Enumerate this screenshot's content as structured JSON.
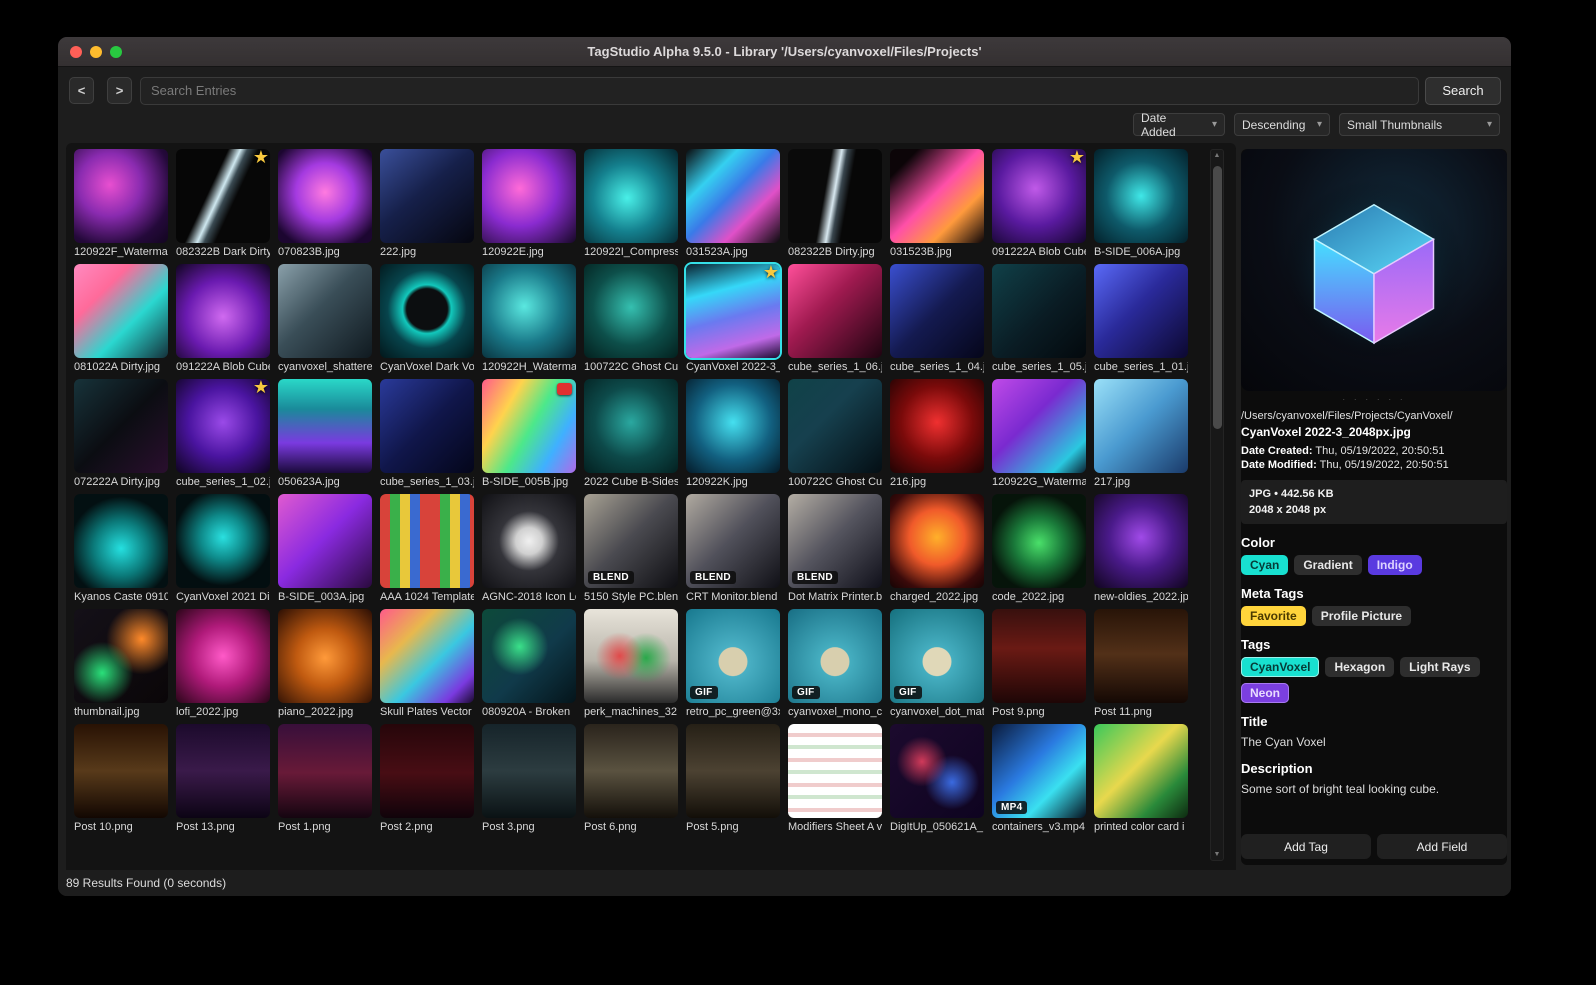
{
  "window": {
    "title": "TagStudio Alpha 9.5.0 - Library '/Users/cyanvoxel/Files/Projects'"
  },
  "toolbar": {
    "back_label": "<",
    "forward_label": ">",
    "search_placeholder": "Search Entries",
    "search_button": "Search"
  },
  "filters": {
    "sort_field": "Date Added",
    "sort_order": "Descending",
    "thumb_size": "Small Thumbnails"
  },
  "statusbar": {
    "results": "89 Results Found (0 seconds)"
  },
  "grid": {
    "items": [
      {
        "label": "120922F_Watermar",
        "bg": "radial-gradient(circle at 38% 38%, #e84fd0 0%, #8a2bb0 38%, #24093a 75%, #12051f 100%)"
      },
      {
        "label": "082322B Dark Dirty",
        "badge": "star",
        "bg": "linear-gradient(115deg, #060606 38%, #cfe8f0 47%, #3a4a52 52%, #070707 60%)"
      },
      {
        "label": "070823B.jpg",
        "bg": "radial-gradient(circle at 50% 46%, #ff7ae0 0%, #a43ae0 42%, #1c0630 85%)"
      },
      {
        "label": "222.jpg",
        "bg": "linear-gradient(140deg, #3a4f9a 0%, #16204a 45%, #05060f 100%)"
      },
      {
        "label": "120922E.jpg",
        "bg": "radial-gradient(circle at 40% 42%, #ff6ad8 0%, #8a2bd0 48%, #160826 100%)"
      },
      {
        "label": "120922I_Compress",
        "bg": "radial-gradient(circle at 46% 52%, #49f0e8 0%, #14808e 48%, #04252e 100%)"
      },
      {
        "label": "031523A.jpg",
        "bg": "linear-gradient(135deg, #0a0a0c 0%, #35d0f0 28%, #3a7ae8 48%, #e050c8 70%, #0a0a0c 100%)"
      },
      {
        "label": "082322B Dirty.jpg",
        "bg": "linear-gradient(100deg, #0a0a0a 40%, #d8e8f0 49%, #39464e 54%, #070707 62%)"
      },
      {
        "label": "031523B.jpg",
        "bg": "linear-gradient(135deg, #0c0508 15%, #ff4fa8 48%, #ff9a3d 72%, #0c0508 100%)"
      },
      {
        "label": "091222A Blob Cube",
        "badge": "star",
        "bg": "radial-gradient(circle at 46% 42%, #c05ae8 0%, #5a1aa0 50%, #12052a 100%)"
      },
      {
        "label": "B-SIDE_006A.jpg",
        "bg": "radial-gradient(circle at 50% 50%, #3fe8e8 0%, #0e5a6a 52%, #03202a 100%)"
      },
      {
        "label": "081022A Dirty.jpg",
        "bg": "linear-gradient(135deg, #ff8ac0 0%, #ff6a9a 30%, #2ad8d0 62%, #14303a 100%)"
      },
      {
        "label": "091222A Blob Cube",
        "bg": "radial-gradient(circle at 50% 56%, #d06af0 0%, #6a1ab0 52%, #10051f 100%)"
      },
      {
        "label": "cyanvoxel_shattere",
        "bg": "linear-gradient(135deg, #8aa0aa 0%, #3a4e58 45%, #101a20 100%)"
      },
      {
        "label": "CyanVoxel Dark Vox",
        "bg": "radial-gradient(circle at 50% 48%, #0c0e10 30%, #12c8bc 36%, #07444c 58%, #02161a 100%)"
      },
      {
        "label": "120922H_Waterma",
        "bg": "radial-gradient(circle at 45% 45%, #5ae8e0 0%, #1a7a8a 50%, #062530 100%)"
      },
      {
        "label": "100722C Ghost Cu",
        "bg": "radial-gradient(circle at 50% 46%, #35c0b0 0%, #0d4f4a 55%, #03201e 100%)"
      },
      {
        "label": "CyanVoxel 2022-3_",
        "badge": "star",
        "selected": true,
        "bg": "linear-gradient(165deg, #0a2230 0%, #35d8f8 30%, #6a7af0 55%, #c06ae8 80%, #1a0a2e 100%)"
      },
      {
        "label": "cube_series_1_06.j",
        "bg": "linear-gradient(135deg, #ff4f9a 0%, #a01a50 42%, #1e0410 100%)"
      },
      {
        "label": "cube_series_1_04.j",
        "bg": "linear-gradient(135deg, #3a4fd0 0%, #141a50 50%, #05061a 100%)"
      },
      {
        "label": "cube_series_1_05.j",
        "bg": "linear-gradient(135deg, #104048 0%, #0a1c24 55%, #03090d 100%)"
      },
      {
        "label": "cube_series_1_01.j",
        "bg": "linear-gradient(135deg, #5a6af8 0%, #2a2a9a 45%, #0c0830 100%)"
      },
      {
        "label": "072222A Dirty.jpg",
        "bg": "linear-gradient(135deg, #17333a 0%, #0b0d12 50%, #2a0f2e 100%)"
      },
      {
        "label": "cube_series_1_02.j",
        "badge": "star",
        "bg": "radial-gradient(circle at 50% 46%, #9a4ae8 0%, #4a14a0 50%, #0e041f 100%)"
      },
      {
        "label": "050623A.jpg",
        "bg": "linear-gradient(180deg, #2ad8c8 0%, #1a8a9a 32%, #7a3ae0 68%, #1a0a3a 100%)"
      },
      {
        "label": "cube_series_1_03.j",
        "bg": "linear-gradient(135deg, #2a3a9a 0%, #10164a 50%, #04061a 100%)"
      },
      {
        "label": "B-SIDE_005B.jpg",
        "badge": "archive",
        "bg": "linear-gradient(120deg, #ff5b8a 0%, #ffd34d 28%, #4de88a 52%, #3fb0ff 76%, #b06ae8 100%)"
      },
      {
        "label": "2022 Cube B-Sides",
        "bg": "radial-gradient(circle at 50% 46%, #2aa8a0 0%, #0d4a4a 52%, #032020 100%)"
      },
      {
        "label": "120922K.jpg",
        "bg": "radial-gradient(circle at 50% 46%, #45e0f0 0%, #126080 55%, #041a28 100%)"
      },
      {
        "label": "100722C Ghost Cu",
        "bg": "linear-gradient(135deg, #104248 0%, #16404e 40%, #040e14 100%)"
      },
      {
        "label": "216.jpg",
        "bg": "radial-gradient(circle at 50% 46%, #f03030 0%, #7a0a0a 52%, #1e0303 100%)"
      },
      {
        "label": "120922G_Waterma",
        "bg": "linear-gradient(135deg, #c04ae8 0%, #7a2ad0 42%, #2ac8e0 82%, #0a2030 100%)"
      },
      {
        "label": "217.jpg",
        "bg": "linear-gradient(135deg, #9ae0f8 0%, #4a9ad0 48%, #1a3a6a 100%)"
      },
      {
        "label": "Kyanos Caste 0910",
        "bg": "radial-gradient(circle at 50% 58%, #25e0e0 0%, #0b7a7a 38%, #031012 72%)"
      },
      {
        "label": "CyanVoxel 2021 Dis",
        "bg": "radial-gradient(circle at 50% 46%, #2ae0e0 0%, #0e8a8a 32%, #030e10 70%)"
      },
      {
        "label": "B-SIDE_003A.jpg",
        "bg": "linear-gradient(135deg, #e05ad0 0%, #8a2ae0 48%, #2a0a3e 100%)"
      },
      {
        "label": "AAA 1024 Template",
        "bg": "repeating-linear-gradient(90deg, #d8433a 0 10px, #3ab04a 10px 20px, #e8c83a 20px 30px, #3a6ad0 30px 40px, #d8433a 40px 50px)"
      },
      {
        "label": "AGNC-2018 Icon Lo",
        "bg": "radial-gradient(circle at 50% 50%, #f0f0f0 0%, #d0d0d0 20%, #34343a 45%, #101014 100%)"
      },
      {
        "label": "5150 Style PC.blend",
        "badge": "BLEND",
        "bg": "linear-gradient(135deg, #a8a294 0%, #4a4a50 48%, #0e0e12 100%)"
      },
      {
        "label": "CRT Monitor.blend",
        "badge": "BLEND",
        "bg": "linear-gradient(135deg, #b0aaa0 0%, #50505a 48%, #101016 100%)"
      },
      {
        "label": "Dot Matrix Printer.b",
        "badge": "BLEND",
        "bg": "linear-gradient(135deg, #b4aea4 0%, #54545e 48%, #10101a 100%)"
      },
      {
        "label": "charged_2022.jpg",
        "bg": "radial-gradient(circle at 50% 46%, #ffb02a 0%, #f05a2a 40%, #3a0a0a 78%, #140404 100%)"
      },
      {
        "label": "code_2022.jpg",
        "bg": "radial-gradient(circle at 50% 52%, #4ae06a 0%, #1a7a3a 36%, #06140a 72%)"
      },
      {
        "label": "new-oldies_2022.jp",
        "bg": "radial-gradient(circle at 50% 46%, #a04ae8 0%, #4a1a8a 46%, #10051e 100%)"
      },
      {
        "label": "thumbnail.jpg",
        "bg": "radial-gradient(circle at 30% 68%, #2ae07a 0%, rgba(0,0,0,0) 34%), radial-gradient(circle at 72% 32%, #ff8a2a 0%, rgba(0,0,0,0) 38%), linear-gradient(135deg, #141018 0%, #0a0608 100%)"
      },
      {
        "label": "lofi_2022.jpg",
        "bg": "radial-gradient(circle at 50% 50%, #ff5ac8 0%, #b01a7a 46%, #2a0518 100%)"
      },
      {
        "label": "piano_2022.jpg",
        "bg": "radial-gradient(circle at 50% 52%, #ff9a3a 0%, #c05a10 42%, #2a0e04 100%)"
      },
      {
        "label": "Skull Plates Vector",
        "bg": "linear-gradient(135deg, #ff5a8a 0%, #e8b84d 30%, #3ac8e0 58%, #7a3ae0 84%, #1a0a2e 100%)"
      },
      {
        "label": "080920A - Broken ",
        "bg": "radial-gradient(circle at 40% 40%, #3ae08a 0%, rgba(0,0,0,0) 36%), linear-gradient(135deg, #0d4a3a 0%, #103a4a 55%, #04141a 100%)"
      },
      {
        "label": "perk_machines_32",
        "bg": "radial-gradient(circle at 38% 50%, #e04a4a 0%, rgba(0,0,0,0) 32%), radial-gradient(circle at 66% 52%, #2aa84a 0%, rgba(0,0,0,0) 32%), linear-gradient(180deg, #e8e4da 0%, #b8b4aa 55%, #2a2a2a 100%)"
      },
      {
        "label": "retro_pc_green@3x",
        "badge": "GIF",
        "bg": "radial-gradient(circle at 50% 56%, #d8cfae 0%, #d8cfae 20%, #4ab0c4 21%, #17788e 100%)"
      },
      {
        "label": "cyanvoxel_mono_cr",
        "badge": "GIF",
        "bg": "radial-gradient(circle at 50% 56%, #d8cfae 0%, #d8cfae 20%, #45aec0 21%, #186e84 100%)"
      },
      {
        "label": "cyanvoxel_dot_mat",
        "badge": "GIF",
        "bg": "radial-gradient(circle at 50% 56%, #e0d8b8 0%, #e0d8b8 20%, #45aec0 21%, #15707e 100%)"
      },
      {
        "label": "Post 9.png",
        "bg": "linear-gradient(180deg, #38100e 0%, #6a1a14 42%, #1e0606 100%)"
      },
      {
        "label": "Post 11.png",
        "bg": "linear-gradient(180deg, #281408 0%, #523018 48%, #140804 100%)"
      },
      {
        "label": "Post 10.png",
        "bg": "linear-gradient(180deg, #281204 0%, #583a1a 50%, #120702 100%)"
      },
      {
        "label": "Post 13.png",
        "bg": "linear-gradient(180deg, #1c0a2c 0%, #3a1a4a 50%, #0c0414 100%)"
      },
      {
        "label": "Post 1.png",
        "bg": "linear-gradient(180deg, #380f3a 0%, #681a38 52%, #140510 100%)"
      },
      {
        "label": "Post 2.png",
        "bg": "linear-gradient(180deg, #26060a 0%, #480d14 52%, #10030a 100%)"
      },
      {
        "label": "Post 3.png",
        "bg": "linear-gradient(180deg, #16242a 0%, #2c3c40 50%, #0a1214 100%)"
      },
      {
        "label": "Post 6.png",
        "bg": "linear-gradient(180deg, #2a241c 0%, #5a5240 50%, #14100a 100%)"
      },
      {
        "label": "Post 5.png",
        "bg": "linear-gradient(180deg, #262016 0%, #4c4232 50%, #120e08 100%)"
      },
      {
        "label": "Modifiers Sheet A v",
        "bg": "repeating-linear-gradient(180deg, #ffffff 0 9px, #f0cccc 9px 13px, #ffffff 13px 21px, #cfe6cf 21px 25px)"
      },
      {
        "label": "DigItUp_050621A_",
        "bg": "radial-gradient(circle at 34% 40%, #d03a5a 0%, rgba(0,0,0,0) 30%), radial-gradient(circle at 66% 62%, #3a6ae0 0%, rgba(0,0,0,0) 32%), linear-gradient(135deg, #1c0a2e 0%, #0e0420 100%)"
      },
      {
        "label": "containers_v3.mp4",
        "badge": "MP4",
        "bg": "linear-gradient(135deg, #0a1a3a 0%, #2a7ae0 42%, #3ae0f0 68%, #06101e 100%)"
      },
      {
        "label": "printed color card i",
        "bg": "linear-gradient(135deg, #3ac85a 0%, #e8d84d 45%, #2a8a3a 75%, #0d2a10 100%)"
      }
    ]
  },
  "inspector": {
    "resize_dots": "· · · · · ·",
    "path": "/Users/cyanvoxel/Files/Projects/CyanVoxel/",
    "filename": "CyanVoxel 2022-3_2048px.jpg",
    "date_created_label": "Date Created:",
    "date_created": "Thu, 05/19/2022, 20:50:51",
    "date_modified_label": "Date Modified:",
    "date_modified": "Thu, 05/19/2022, 20:50:51",
    "file_info_line1": "JPG  •  442.56 KB",
    "file_info_line2": "2048 x 2048 px",
    "sections": [
      {
        "title": "Color",
        "pills": [
          {
            "label": "Cyan",
            "bg": "#18e0d0",
            "fg": "#063c38"
          },
          {
            "label": "Gradient",
            "bg": "#2e2e2e",
            "fg": "#e8e8e8"
          },
          {
            "label": "Indigo",
            "bg": "#5a3ae0",
            "fg": "#ddd2ff"
          }
        ]
      },
      {
        "title": "Meta Tags",
        "pills": [
          {
            "label": "Favorite",
            "bg": "#ffd43b",
            "fg": "#4a3a00"
          },
          {
            "label": "Profile Picture",
            "bg": "#2e2e2e",
            "fg": "#e8e8e8"
          }
        ]
      },
      {
        "title": "Tags",
        "pills": [
          {
            "label": "CyanVoxel",
            "bg": "#18e0d0",
            "fg": "#063c38",
            "border": "#9af2ea"
          },
          {
            "label": "Hexagon",
            "bg": "#2e2e2e",
            "fg": "#e8e8e8"
          },
          {
            "label": "Light Rays",
            "bg": "#2e2e2e",
            "fg": "#e8e8e8"
          },
          {
            "label": "Neon",
            "bg": "#7b3fe0",
            "fg": "#e9dcff",
            "border": "#a87af0"
          }
        ]
      }
    ],
    "title_label": "Title",
    "title_value": "The Cyan Voxel",
    "description_label": "Description",
    "description_value": "Some sort of bright teal looking cube.",
    "add_tag": "Add Tag",
    "add_field": "Add Field"
  }
}
